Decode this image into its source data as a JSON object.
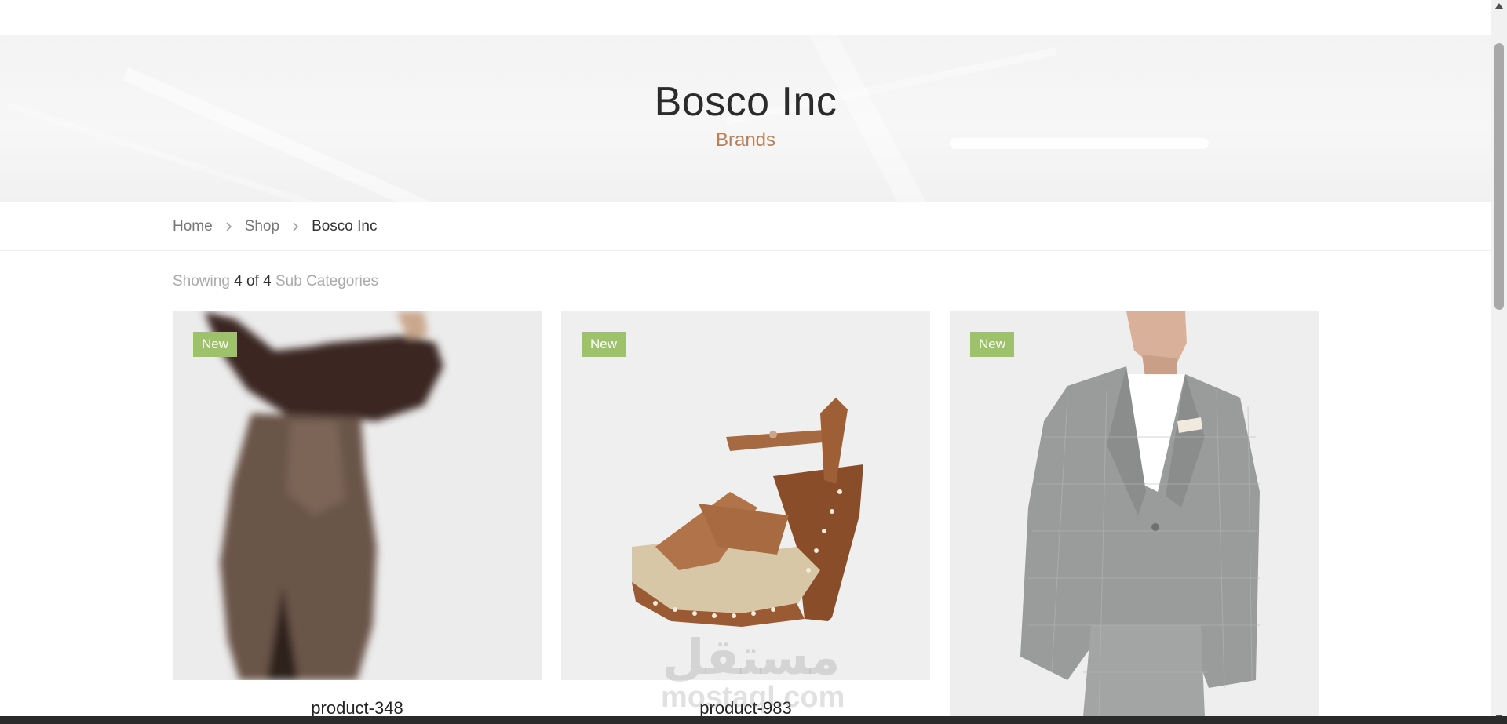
{
  "hero": {
    "title": "Bosco Inc",
    "subtitle": "Brands"
  },
  "breadcrumb": {
    "items": [
      "Home",
      "Shop",
      "Bosco Inc"
    ]
  },
  "results": {
    "prefix": "Showing",
    "count": "4 of 4",
    "suffix": "Sub Categories"
  },
  "products": [
    {
      "name": "product-348",
      "badge": "New"
    },
    {
      "name": "product-983",
      "badge": "New"
    },
    {
      "name": "",
      "badge": "New"
    }
  ],
  "watermark": {
    "arabic": "مستقل",
    "latin": "mostaql.com"
  },
  "colors": {
    "accent": "#b9805a",
    "badge": "#9dc26b"
  }
}
